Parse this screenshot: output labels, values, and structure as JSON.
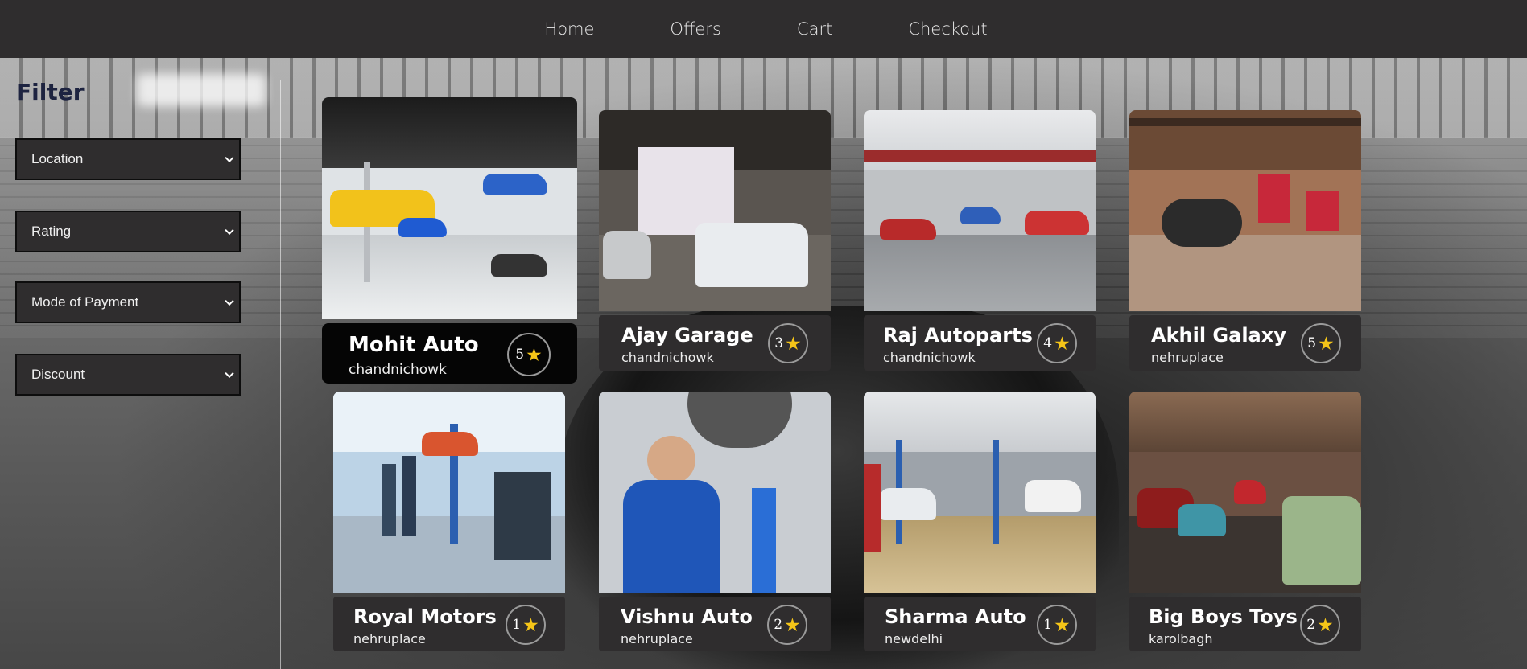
{
  "nav": {
    "items": [
      {
        "label": "Home"
      },
      {
        "label": "Offers"
      },
      {
        "label": "Cart"
      },
      {
        "label": "Checkout"
      }
    ]
  },
  "sidebar": {
    "title": "Filter",
    "filters": [
      {
        "label": "Location"
      },
      {
        "label": "Rating"
      },
      {
        "label": "Mode of Payment"
      },
      {
        "label": "Discount"
      }
    ]
  },
  "garages": [
    {
      "name": "Mohit Auto",
      "location": "chandnichowk",
      "rating": "5",
      "icon": "star-icon"
    },
    {
      "name": "Ajay Garage",
      "location": "chandnichowk",
      "rating": "3",
      "icon": "star-icon"
    },
    {
      "name": "Raj Autoparts",
      "location": "chandnichowk",
      "rating": "4",
      "icon": "star-icon"
    },
    {
      "name": "Akhil Galaxy",
      "location": "nehruplace",
      "rating": "5",
      "icon": "star-icon"
    },
    {
      "name": "Royal Motors",
      "location": "nehruplace",
      "rating": "1",
      "icon": "star-icon"
    },
    {
      "name": "Vishnu Auto",
      "location": "nehruplace",
      "rating": "2",
      "icon": "star-icon"
    },
    {
      "name": "Sharma Auto",
      "location": "newdelhi",
      "rating": "1",
      "icon": "star-icon"
    },
    {
      "name": "Big Boys Toys",
      "location": "karolbagh",
      "rating": "2",
      "icon": "star-icon"
    }
  ],
  "colors": {
    "navbar": "#2f2d2e",
    "card_info": "#2f2d2e",
    "featured_info": "#050505",
    "filter_title": "#1d2340",
    "star": "#f5c518"
  }
}
